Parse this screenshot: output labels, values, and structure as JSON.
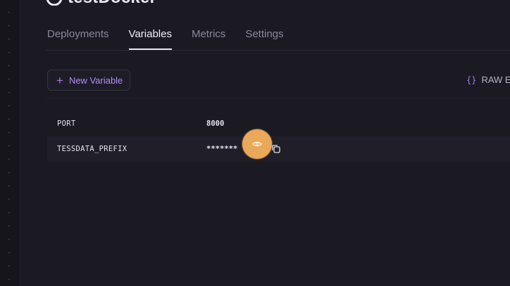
{
  "project": {
    "title": "testDocker"
  },
  "tabs": [
    {
      "label": "Deployments"
    },
    {
      "label": "Variables"
    },
    {
      "label": "Metrics"
    },
    {
      "label": "Settings"
    }
  ],
  "toolbar": {
    "new_variable_label": "New Variable",
    "raw_editor_label": "RAW Ed",
    "raw_editor_icon": "{}"
  },
  "variables": [
    {
      "key": "PORT",
      "value": "8000"
    },
    {
      "key": "TESSDATA_PREFIX",
      "value": "*******"
    }
  ],
  "colors": {
    "background": "#1b1a23",
    "accent": "#b18cf5",
    "highlight": "#e9a85a"
  }
}
